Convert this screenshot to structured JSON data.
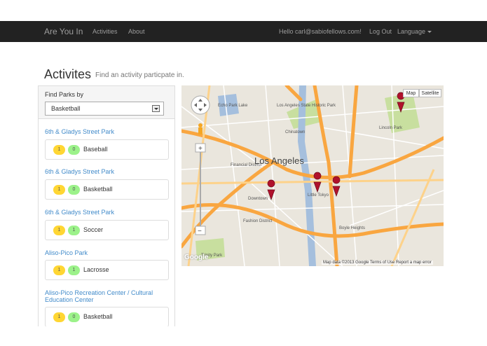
{
  "navbar": {
    "brand": "Are You In",
    "links": [
      "Activities",
      "About"
    ],
    "greeting": "Hello carl@sabiofellows.com!",
    "logout": "Log Out",
    "language": "Language"
  },
  "header": {
    "title": "Activites",
    "subtitle": "Find an activity particpate in."
  },
  "filter": {
    "label": "Find Parks by",
    "selected": "Basketball"
  },
  "parks": [
    {
      "name": "6th & Gladys Street Park",
      "count_a": "1",
      "count_b": "0",
      "activity": "Baseball"
    },
    {
      "name": "6th & Gladys Street Park",
      "count_a": "1",
      "count_b": "0",
      "activity": "Basketball"
    },
    {
      "name": "6th & Gladys Street Park",
      "count_a": "1",
      "count_b": "1",
      "activity": "Soccer"
    },
    {
      "name": "Aliso-Pico Park",
      "count_a": "1",
      "count_b": "1",
      "activity": "Lacrosse"
    },
    {
      "name": "Aliso-Pico Recreation Center / Cultural Education Center",
      "count_a": "1",
      "count_b": "0",
      "activity": "Basketball"
    }
  ],
  "map": {
    "map_button": "Map",
    "satellite_button": "Satellite",
    "zoom_in": "+",
    "zoom_out": "−",
    "city_label": "Los Angeles",
    "labels": [
      "Chinatown",
      "Downtown",
      "Little Tokyo",
      "Boyle Heights",
      "Trinity Park",
      "Lincoln Park",
      "Los Angeles State Historic Park",
      "Echo Park Lake",
      "Financial District",
      "Fashion District"
    ],
    "attribution": "Map data ©2013 Google   Terms of Use   Report a map error",
    "logo": "Google",
    "colors": {
      "highway": "#f9a640",
      "marker": "#b0122c",
      "water": "#a5bfdd",
      "park": "#c8df9f"
    }
  }
}
